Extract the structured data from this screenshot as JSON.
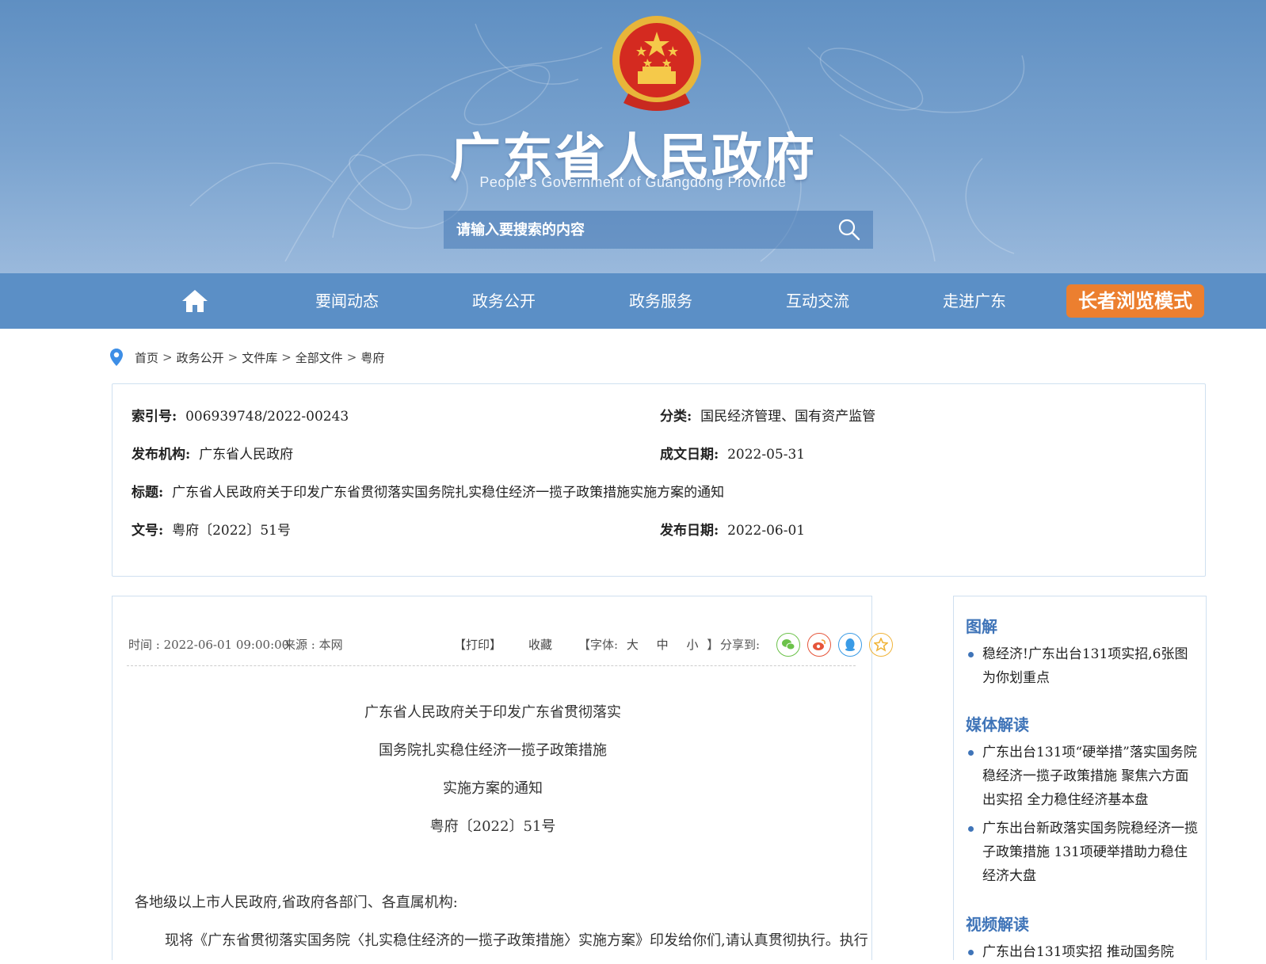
{
  "header": {
    "title": "广东省人民政府",
    "subtitle": "People's Government of Guangdong Province",
    "search_placeholder": "请输入要搜索的内容",
    "search_icon": "search-icon"
  },
  "nav": {
    "home_icon": "home-icon",
    "items": [
      "要闻动态",
      "政务公开",
      "政务服务",
      "互动交流",
      "走进广东"
    ],
    "elder_mode": "长者浏览模式"
  },
  "breadcrumb": [
    "首页",
    "政务公开",
    "文件库",
    "全部文件",
    "粤府"
  ],
  "meta": {
    "index_label": "索引号:",
    "index_value": "006939748/2022-00243",
    "category_label": "分类:",
    "category_value": "国民经济管理、国有资产监管",
    "issuer_label": "发布机构:",
    "issuer_value": "广东省人民政府",
    "created_label": "成文日期:",
    "created_value": "2022-05-31",
    "title_label": "标题:",
    "title_value": "广东省人民政府关于印发广东省贯彻落实国务院扎实稳住经济一揽子政策措施实施方案的通知",
    "docno_label": "文号:",
    "docno_value": "粤府〔2022〕51号",
    "published_label": "发布日期:",
    "published_value": "2022-06-01"
  },
  "toolbar": {
    "time": "时间 : 2022-06-01 09:00:00",
    "source": "来源 : 本网",
    "print": "【打印】",
    "favorite": "收藏",
    "font_prefix": "【字体:",
    "font_large": "大",
    "font_medium": "中",
    "font_small": "小",
    "font_suffix": "】",
    "share_label": "分享到:"
  },
  "document": {
    "title_lines": [
      "广东省人民政府关于印发广东省贯彻落实",
      "国务院扎实稳住经济一揽子政策措施",
      "实施方案的通知"
    ],
    "doc_no": "粤府〔2022〕51号",
    "salutation": "各地级以上市人民政府,省政府各部门、各直属机构:",
    "para1": "现将《广东省贯彻落实国务院〈扎实稳住经济的一揽子政策措施〉实施方案》印发给你们,请认真贯彻执行。执行"
  },
  "sidebar": {
    "sections": [
      {
        "heading": "图解",
        "items": [
          "稳经济!广东出台131项实招,6张图为你划重点"
        ]
      },
      {
        "heading": "媒体解读",
        "items": [
          "广东出台131项“硬举措”落实国务院稳经济一揽子政策措施 聚焦六方面出实招 全力稳住经济基本盘",
          "广东出台新政落实国务院稳经济一揽子政策措施 131项硬举措助力稳住经济大盘"
        ]
      },
      {
        "heading": "视频解读",
        "items": [
          "广东出台131项实招 推动国务院"
        ]
      }
    ]
  },
  "colors": {
    "nav": "#5b8fc6",
    "elder": "#ec7f2f",
    "accent": "#3f74b8"
  }
}
